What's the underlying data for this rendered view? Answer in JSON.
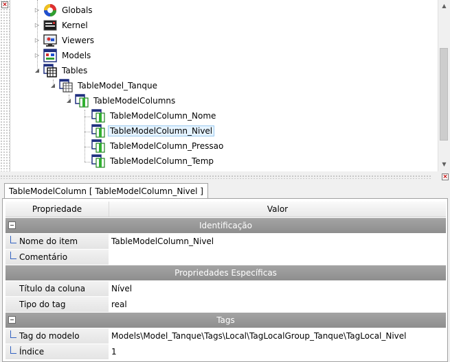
{
  "tree": {
    "items": [
      {
        "label": "Globals",
        "icon": "globals-icon",
        "toggle": "▷"
      },
      {
        "label": "Kernel",
        "icon": "kernel-icon",
        "toggle": "▷"
      },
      {
        "label": "Viewers",
        "icon": "viewers-icon",
        "toggle": "▷"
      },
      {
        "label": "Models",
        "icon": "models-icon",
        "toggle": "▷"
      },
      {
        "label": "Tables",
        "icon": "tables-icon",
        "toggle": "◢"
      },
      {
        "label": "TableModel_Tanque",
        "icon": "table-model-icon",
        "toggle": "◢"
      },
      {
        "label": "TableModelColumns",
        "icon": "table-columns-icon",
        "toggle": "◢"
      },
      {
        "label": "TableModelColumn_Nome",
        "icon": "table-column-icon"
      },
      {
        "label": "TableModelColumn_Nivel",
        "icon": "table-column-icon",
        "selected": true
      },
      {
        "label": "TableModelColumn_Pressao",
        "icon": "table-column-icon"
      },
      {
        "label": "TableModelColumn_Temp",
        "icon": "table-column-icon"
      }
    ]
  },
  "panel": {
    "tab_title": "TableModelColumn [ TableModelColumn_Nivel ]",
    "col_property": "Propriedade",
    "col_value": "Valor",
    "sections": [
      {
        "title": "Identificação",
        "rows": [
          {
            "prop": "Nome do item",
            "value": "TableModelColumn_Nivel"
          },
          {
            "prop": "Comentário",
            "value": ""
          }
        ]
      },
      {
        "title": "Propriedades Específicas",
        "rows": [
          {
            "prop": "Título da coluna",
            "value": "Nível"
          },
          {
            "prop": "Tipo do tag",
            "value": "real"
          }
        ]
      },
      {
        "title": "Tags",
        "rows": [
          {
            "prop": "Tag do modelo",
            "value": "Models\\Model_Tanque\\Tags\\Local\\TagLocalGroup_Tanque\\TagLocal_Nivel"
          },
          {
            "prop": "Índice",
            "value": "1"
          }
        ]
      }
    ]
  },
  "colors": {
    "section_header": "#999999",
    "selection_bg": "#e5f3ff",
    "selection_border": "#99c9ef",
    "close_glyph": "#c00000"
  }
}
